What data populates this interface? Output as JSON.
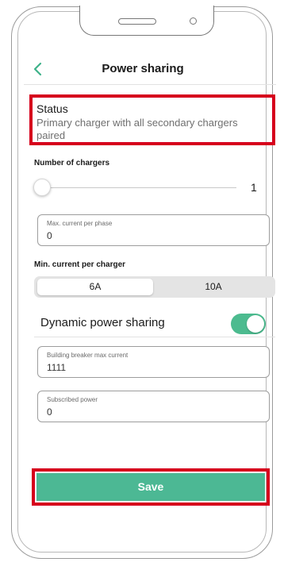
{
  "header": {
    "title": "Power sharing"
  },
  "status": {
    "title": "Status",
    "description": "Primary charger with all secondary chargers paired"
  },
  "chargers": {
    "label": "Number of chargers",
    "value": "1"
  },
  "max_current": {
    "label": "Max. current per phase",
    "value": "0"
  },
  "min_current": {
    "label": "Min. current per charger",
    "options": [
      "6A",
      "10A"
    ],
    "selected": "6A"
  },
  "dynamic_power_sharing": {
    "label": "Dynamic power sharing",
    "enabled": true
  },
  "building_breaker": {
    "label": "Building breaker max current",
    "value": "1111"
  },
  "subscribed_power": {
    "label": "Subscribed power",
    "value": "0"
  },
  "save": {
    "label": "Save"
  },
  "colors": {
    "accent": "#4cb894",
    "highlight": "#d6001c"
  },
  "icons": {
    "back": "chevron-left-icon"
  }
}
